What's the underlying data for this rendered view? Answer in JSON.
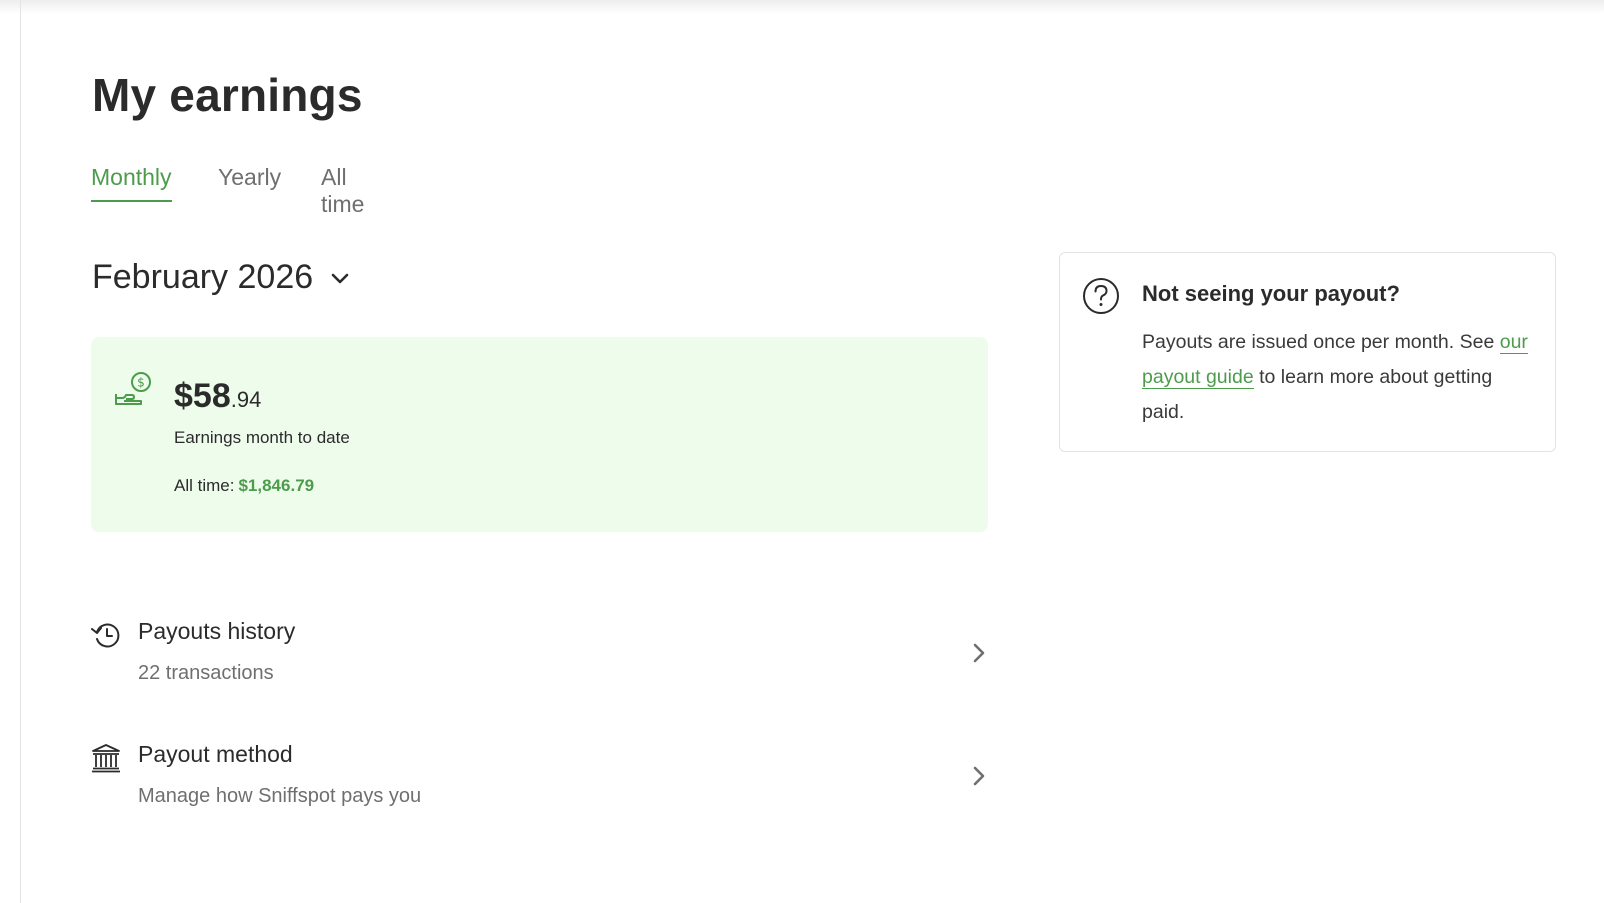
{
  "page": {
    "title": "My earnings"
  },
  "tabs": [
    {
      "label": "Monthly",
      "active": true
    },
    {
      "label": "Yearly",
      "active": false
    },
    {
      "label": "All time",
      "active": false
    }
  ],
  "period": {
    "label": "February 2026",
    "icon": "chevron-down-icon"
  },
  "earnings": {
    "icon": "hand-dollar-icon",
    "amount_main": "$58",
    "amount_cents": ".94",
    "caption": "Earnings month to date",
    "all_time_label": "All time:",
    "all_time_value": "$1,846.79"
  },
  "rows": [
    {
      "icon": "history-clock-icon",
      "title": "Payouts history",
      "subtitle": "22 transactions"
    },
    {
      "icon": "bank-icon",
      "title": "Payout method",
      "subtitle": "Manage how Sniffspot pays you"
    }
  ],
  "help": {
    "icon": "question-circle-icon",
    "title": "Not seeing your payout?",
    "text_1": "Payouts are issued once per month. See ",
    "link_text": "our payout guide",
    "text_2": " to learn more about getting paid."
  },
  "colors": {
    "accent": "#4c9c4c",
    "card_background": "#eefcec",
    "text": "#2b2b2b",
    "muted_text": "#6f6f6f"
  }
}
